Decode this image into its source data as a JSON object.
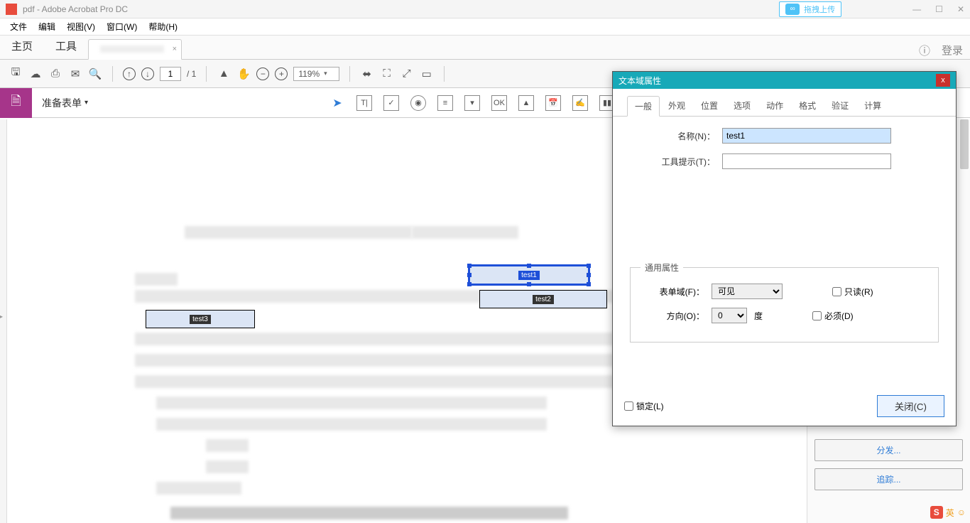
{
  "titlebar": {
    "title": "pdf - Adobe Acrobat Pro DC",
    "upload_btn": "拖拽上传"
  },
  "menubar": {
    "file": "文件",
    "edit": "编辑",
    "view": "视图(V)",
    "window": "窗口(W)",
    "help": "帮助(H)"
  },
  "tabbar": {
    "home": "主页",
    "tools": "工具",
    "doctab_x": "×",
    "login": "登录"
  },
  "toolbar": {
    "page_current": "1",
    "page_total": "/ 1",
    "zoom": "119%"
  },
  "secondbar": {
    "prepare_form": "准备表单"
  },
  "fields": {
    "f1": "test1",
    "f2": "test2",
    "f3": "test3"
  },
  "dialog": {
    "title": "文本域属性",
    "x": "x",
    "tabs": [
      "一般",
      "外观",
      "位置",
      "选项",
      "动作",
      "格式",
      "验证",
      "计算"
    ],
    "name_label": "名称(N)：",
    "name_val": "test1",
    "tooltip_label": "工具提示(T)：",
    "tooltip_val": "",
    "common_legend": "通用属性",
    "formfield_label": "表单域(F)：",
    "formfield_val": "可见",
    "readonly_label": "只读(R)",
    "direction_label": "方向(O)：",
    "direction_val": "0",
    "degree": "度",
    "required_label": "必须(D)",
    "locked_label": "锁定(L)",
    "close_btn": "关闭(C)"
  },
  "right_panel": {
    "distribute": "分发...",
    "track": "追踪..."
  },
  "ime": {
    "char": "英"
  }
}
